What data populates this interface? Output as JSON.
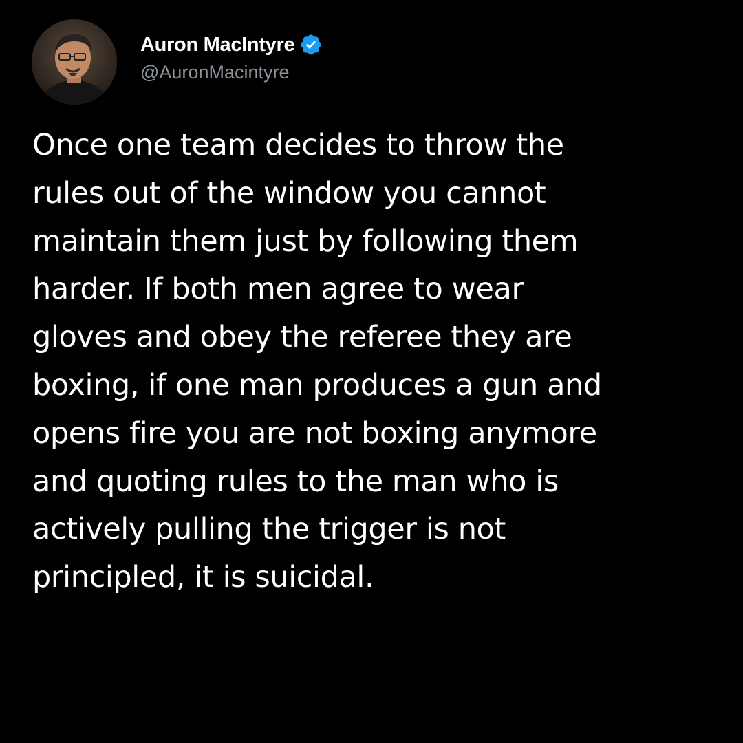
{
  "author": {
    "display_name": "Auron MacIntyre",
    "handle": "@AuronMacintyre",
    "verified": true,
    "avatar_icon": "profile-photo",
    "verified_icon": "verified-badge-icon"
  },
  "tweet": {
    "text": "Once one team decides to throw the\nrules out of the window you cannot\nmaintain them just by following them\nharder. If both men agree to wear\ngloves and obey the referee they are\nboxing, if one man produces a gun and\nopens fire you are not boxing anymore\nand quoting rules to the man who is\nactively pulling the trigger is not\nprincipled, it is suicidal."
  },
  "colors": {
    "background": "#000000",
    "text": "#ffffff",
    "handle": "#8b9299",
    "verified": "#1d9bf0"
  }
}
